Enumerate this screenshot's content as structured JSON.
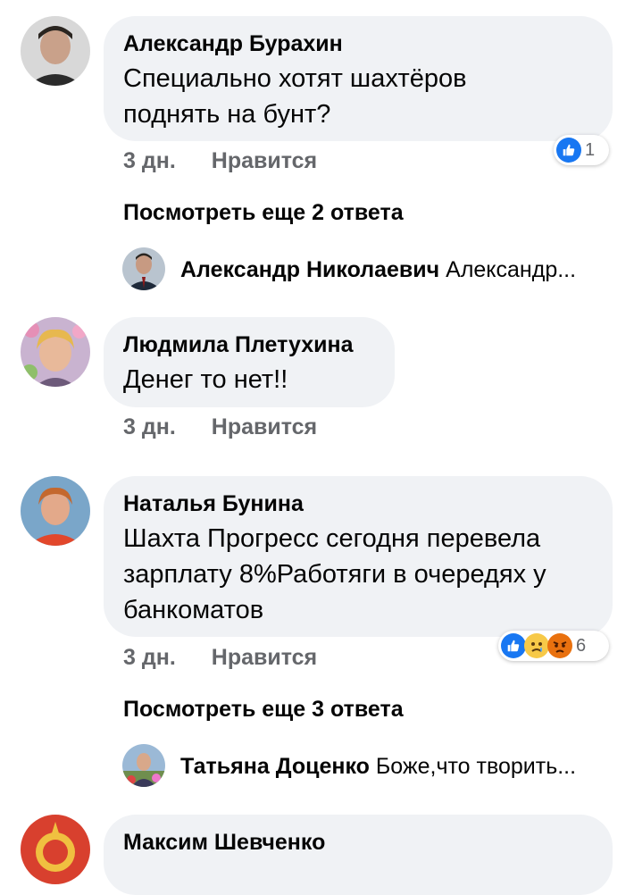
{
  "comments": [
    {
      "author": "Александр Бурахин",
      "text_lines": [
        "Специально хотят шахтёров",
        "поднять на бунт?"
      ],
      "time": "3 дн.",
      "like_label": "Нравится",
      "reaction_count": "1",
      "more_replies": "Посмотреть еще 2 ответа",
      "reply_author": "Александр Николаевич",
      "reply_text": "Александр..."
    },
    {
      "author": "Людмила Плетухина",
      "text_lines": [
        "Денег то нет!!"
      ],
      "time": "3 дн.",
      "like_label": "Нравится"
    },
    {
      "author": "Наталья Бунина",
      "text_lines": [
        "Шахта Прогресс  сегодня перевела",
        "зарплату 8%Работяги в очередях у",
        "банкоматов"
      ],
      "time": "3 дн.",
      "like_label": "Нравится",
      "reaction_count": "6",
      "more_replies": "Посмотреть еще 3 ответа",
      "reply_author": "Татьяна Доценко",
      "reply_text": "Боже,что творить..."
    },
    {
      "author": "Максим Шевченко"
    }
  ],
  "colors": {
    "bubble": "#f0f2f5",
    "meta": "#65676b",
    "like_blue": "#1877f2",
    "angry": "#e9710f"
  }
}
